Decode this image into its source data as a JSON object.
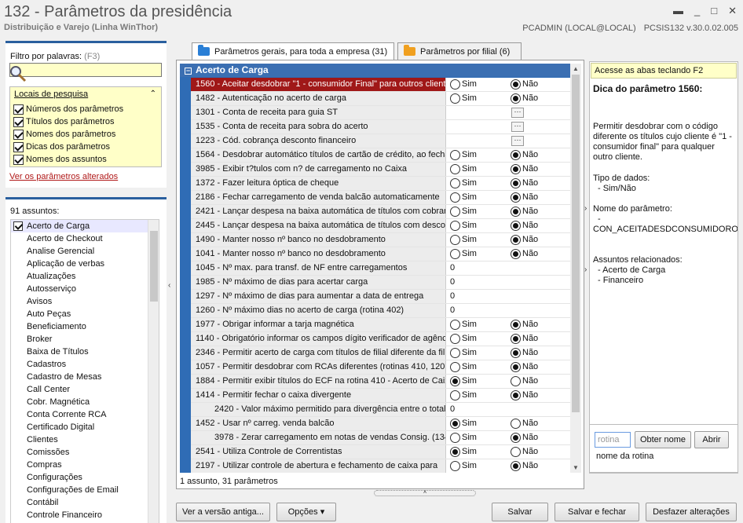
{
  "window": {
    "title": "132 - Parâmetros da presidência",
    "subtitle": "Distribuição e Varejo (Linha WinThor)",
    "user": "PCADMIN (LOCAL@LOCAL)",
    "version": "PCSIS132  v.30.0.02.005"
  },
  "filter": {
    "label": "Filtro por palavras:",
    "hint": "(F3)",
    "value": "",
    "locais_title": "Locais de pesquisa",
    "locais": [
      {
        "label": "Números dos parâmetros",
        "checked": true
      },
      {
        "label": "Títulos dos parâmetros",
        "checked": true
      },
      {
        "label": "Nomes dos parâmetros",
        "checked": true
      },
      {
        "label": "Dicas dos parâmetros",
        "checked": true
      },
      {
        "label": "Nomes dos assuntos",
        "checked": true
      }
    ],
    "altered_link": "Ver os parâmetros alterados"
  },
  "assuntos": {
    "count_label": "91 assuntos:",
    "items": [
      "Acerto de Carga",
      "Acerto de Checkout",
      "Analise Gerencial",
      "Aplicação de verbas",
      "Atualizações",
      "Autosserviço",
      "Avisos",
      "Auto Peças",
      "Beneficiamento",
      "Broker",
      "Baixa de Títulos",
      "Cadastros",
      "Cadastro de Mesas",
      "Call Center",
      "Cobr. Magnética",
      "Conta Corrente RCA",
      "Certificado Digital",
      "Clientes",
      "Comissões",
      "Compras",
      "Configurações",
      "Configurações de Email",
      "Contábil",
      "Controle Financeiro"
    ]
  },
  "tabs": [
    {
      "label": "Parâmetros gerais, para toda a empresa",
      "count": "(31)",
      "folder_color": "#2a7fd6"
    },
    {
      "label": "Parâmetros por filial",
      "count": "(6)",
      "folder_color": "#f0a020"
    }
  ],
  "grid": {
    "group": "Acerto de Carga",
    "sim": "Sim",
    "nao": "Não",
    "dots": "···",
    "rows": [
      {
        "label": "1560 - Aceitar desdobrar \"1 - consumidor Final\" para outros clientes",
        "type": "radio",
        "value": "nao",
        "sel": true
      },
      {
        "label": "1482 - Autenticação no acerto de carga",
        "type": "radio",
        "value": "nao"
      },
      {
        "label": "1301 - Conta de receita para guia ST",
        "type": "dots"
      },
      {
        "label": "1535 - Conta de receita para sobra do acerto",
        "type": "dots"
      },
      {
        "label": "1223 - Cód. cobrança desconto financeiro",
        "type": "dots"
      },
      {
        "label": "1564 - Desdobrar automático títulos de cartão de crédito, ao fechar",
        "type": "radio",
        "value": "nao"
      },
      {
        "label": "3985 - Exibir t?tulos com n? de carregamento no Caixa",
        "type": "radio",
        "value": "nao"
      },
      {
        "label": "1372 - Fazer leitura óptica de cheque",
        "type": "radio",
        "value": "nao"
      },
      {
        "label": "2186 - Fechar carregamento de venda balcão automaticamente",
        "type": "radio",
        "value": "nao"
      },
      {
        "label": "2421 - Lançar despesa na baixa automática de títulos com cobrança",
        "type": "radio",
        "value": "nao"
      },
      {
        "label": "2445 - Lançar despesa na baixa automática de títulos com desconto",
        "type": "radio",
        "value": "nao"
      },
      {
        "label": "1490 - Manter nosso nº banco no desdobramento",
        "type": "radio",
        "value": "nao"
      },
      {
        "label": "1041 - Manter nosso nº banco no desdobramento",
        "type": "radio",
        "value": "nao"
      },
      {
        "label": "1045 - Nº max. para transf. de NF entre carregamentos",
        "type": "num",
        "value": "0"
      },
      {
        "label": "1985 - Nº máximo de dias para acertar carga",
        "type": "num",
        "value": "0"
      },
      {
        "label": "1297 - Nº máximo de dias para aumentar a data de entrega",
        "type": "num",
        "value": "0"
      },
      {
        "label": "1260 - Nº máximo dias no acerto de carga (rotina 402)",
        "type": "num",
        "value": "0"
      },
      {
        "label": "1977 - Obrigar informar a tarja magnética",
        "type": "radio",
        "value": "nao"
      },
      {
        "label": "1140 - Obrigatório informar os campos dígito verificador de agência",
        "type": "radio",
        "value": "nao"
      },
      {
        "label": "2346 - Permitir acerto de carga com títulos de filial diferente da filial",
        "type": "radio",
        "value": "nao"
      },
      {
        "label": "1057 - Permitir desdobrar com RCAs diferentes (rotinas 410, 1207)",
        "type": "radio",
        "value": "nao"
      },
      {
        "label": "1884 - Permitir exibir títulos do ECF na rotina 410 - Acerto de Caixa",
        "type": "radio",
        "value": "sim"
      },
      {
        "label": "1414 - Permitir fechar o caixa divergente",
        "type": "radio",
        "value": "nao"
      },
      {
        "label": "2420 - Valor máximo permitido para divergência entre o total",
        "type": "num",
        "value": "0",
        "indent": true
      },
      {
        "label": "1452 - Usar nº carreg. venda balcão",
        "type": "radio",
        "value": "sim"
      },
      {
        "label": "3978 - Zerar carregamento em notas de vendas Consig. (1349)",
        "type": "radio",
        "value": "nao",
        "indent": true
      },
      {
        "label": "2541 - Utiliza Controle de Correntistas",
        "type": "radio",
        "value": "sim"
      },
      {
        "label": "2197 - Utilizar controle de abertura e fechamento de caixa para",
        "type": "radio",
        "value": "nao"
      }
    ],
    "footer": "1 assunto, 31 parâmetros"
  },
  "tip": {
    "header": "Acesse as abas teclando F2",
    "title": "Dica do parâmetro 1560:",
    "text": "Permitir desdobrar com o código diferente os títulos cujo cliente é \"1 - consumidor final\" para qualquer outro cliente.",
    "tipo_label": "Tipo de dados:",
    "tipo_value": "- Sim/Não",
    "nome_label": "Nome do parâmetro:",
    "nome_dash": "-",
    "nome_value": "CON_ACEITADESDCONSUMIDOROUTROS",
    "assuntos_label": "Assuntos relacionados:",
    "assuntos": [
      "- Acerto de Carga",
      "- Financeiro"
    ]
  },
  "rotina": {
    "placeholder": "rotina",
    "obter": "Obter nome",
    "abrir": "Abrir",
    "label": "nome da rotina"
  },
  "buttons": {
    "versao": "Ver a versão antiga...",
    "opcoes": "Opções",
    "salvar": "Salvar",
    "salvar_fechar": "Salvar e fechar",
    "desfazer": "Desfazer alterações"
  }
}
